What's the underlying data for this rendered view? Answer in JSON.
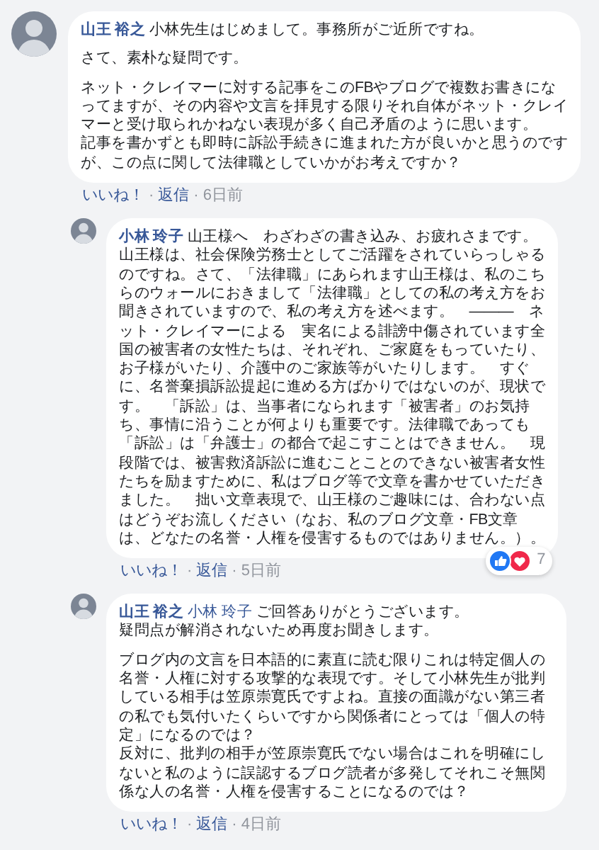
{
  "comments": [
    {
      "kind": "top",
      "author": "山王 裕之",
      "paragraphs": [
        [
          "小林先生はじめまして。事務所がご近所ですね。"
        ],
        [
          "さて、素朴な疑問です。"
        ],
        [
          "ネット・クレイマーに対する記事をこのFBやブログで複数お書きになってますが、その内容や文言を拝見する限りそれ自体がネット・クレイマーと受け取られかねない表現が多く自己矛盾のように思います。",
          "記事を書かずとも即時に訴訟手続きに進まれた方が良いかと思うのですが、この点に関して法律職としていかがお考えですか？"
        ]
      ],
      "like": "いいね！",
      "separator": "·",
      "reply": "返信",
      "time": "6日前"
    },
    {
      "kind": "reply",
      "author": "小林 玲子",
      "paragraphs": [
        [
          "山王様へ　わざわざの書き込み、お疲れさまです。",
          "山王様は、社会保険労務士としてご活躍をされていらっしゃるのですね。さて、「法律職」にあられます山王様は、私のこちらのウォールにおきまして「法律職」としての私の考え方をお聞きされていますので、私の考え方を述べます。　―――　ネット・クレイマーによる　実名による誹謗中傷されています全国の被害者の女性たちは、それぞれ、ご家庭をもっていたり、お子様がいたり、介護中のご家族等がいたりします。　すぐに、名誉棄損訴訟提起に進める方ばかりではないのが、現状です。　「訴訟」は、当事者になられます「被害者」のお気持ち、事情に沿うことが何よりも重要です。法律職であっても「訴訟」は「弁護士」の都合で起こすことはできません。　現段階では、被害救済訴訟に進むことことのできない被害者女性たちを励ますために、私はブログ等で文章を書かせていただきました。　拙い文章表現で、山王様のご趣味には、合わない点はどうぞお流しください（なお、私のブログ文章・FB文章は、どなたの名誉・人権を侵害するものではありません。）。"
        ]
      ],
      "like": "いいね！",
      "separator": "·",
      "reply": "返信",
      "time": "5日前",
      "reactions": {
        "count": "7"
      }
    },
    {
      "kind": "reply",
      "author": "山王 裕之",
      "mention": "小林 玲子",
      "paragraphs": [
        [
          "ご回答ありがとうございます。",
          "疑問点が解消されないため再度お聞きします。"
        ],
        [
          "ブログ内の文言を日本語的に素直に読む限りこれは特定個人の名誉・人権に対する攻撃的な表現です。そして小林先生が批判している相手は笠原崇寛氏ですよね。直接の面識がない第三者の私でも気付いたくらいですから関係者にとっては「個人の特定」になるのでは？",
          "反対に、批判の相手が笠原崇寛氏でない場合はこれを明確にしないと私のように誤認するブログ読者が多発してそれこそ無関係な人の名誉・人権を侵害することになるのでは？"
        ]
      ],
      "like": "いいね！",
      "separator": "·",
      "reply": "返信",
      "time": "4日前"
    }
  ]
}
